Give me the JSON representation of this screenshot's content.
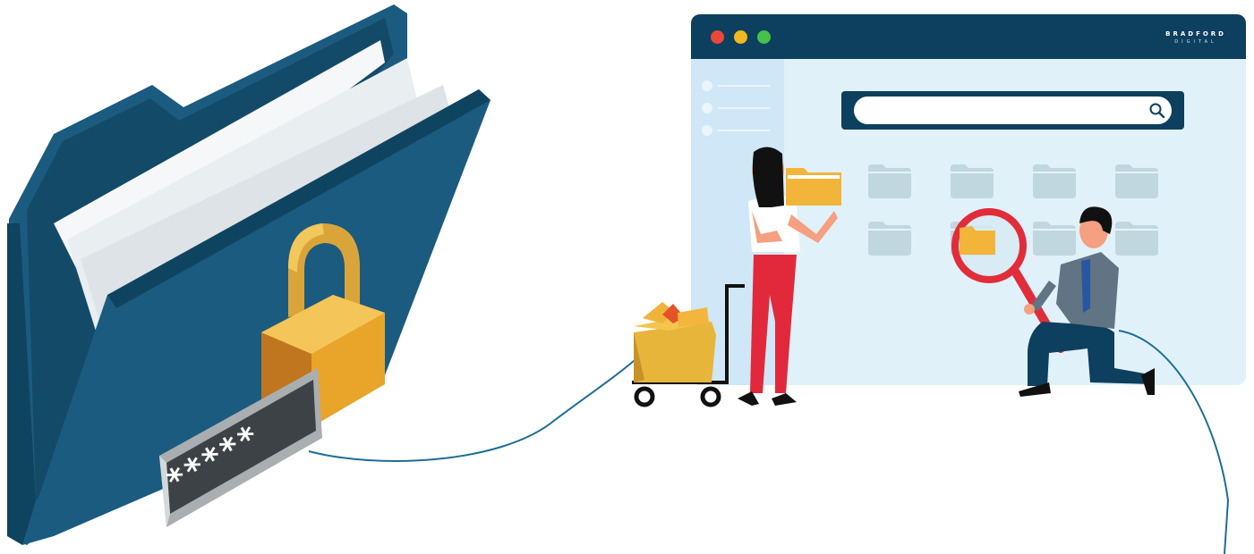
{
  "brand": {
    "name_top": "BRADFORD",
    "name_bottom": "DIGITAL"
  },
  "search": {
    "value": "",
    "placeholder": ""
  },
  "password_field": {
    "masked_value": "*****"
  },
  "window_controls": {
    "close_color": "#e9483b",
    "minimize_color": "#f3b81f",
    "maximize_color": "#45c24a"
  },
  "colors": {
    "navy": "#0d3f5e",
    "window_bg": "#e1f1fa",
    "folder_blue": "#1b5b7f",
    "lock_gold": "#e8a52a",
    "accent_red": "#e12c3a",
    "file_yellow": "#f2b53a"
  },
  "icons": {
    "search": "search-icon",
    "lock": "padlock-icon",
    "folder": "folder-icon"
  }
}
